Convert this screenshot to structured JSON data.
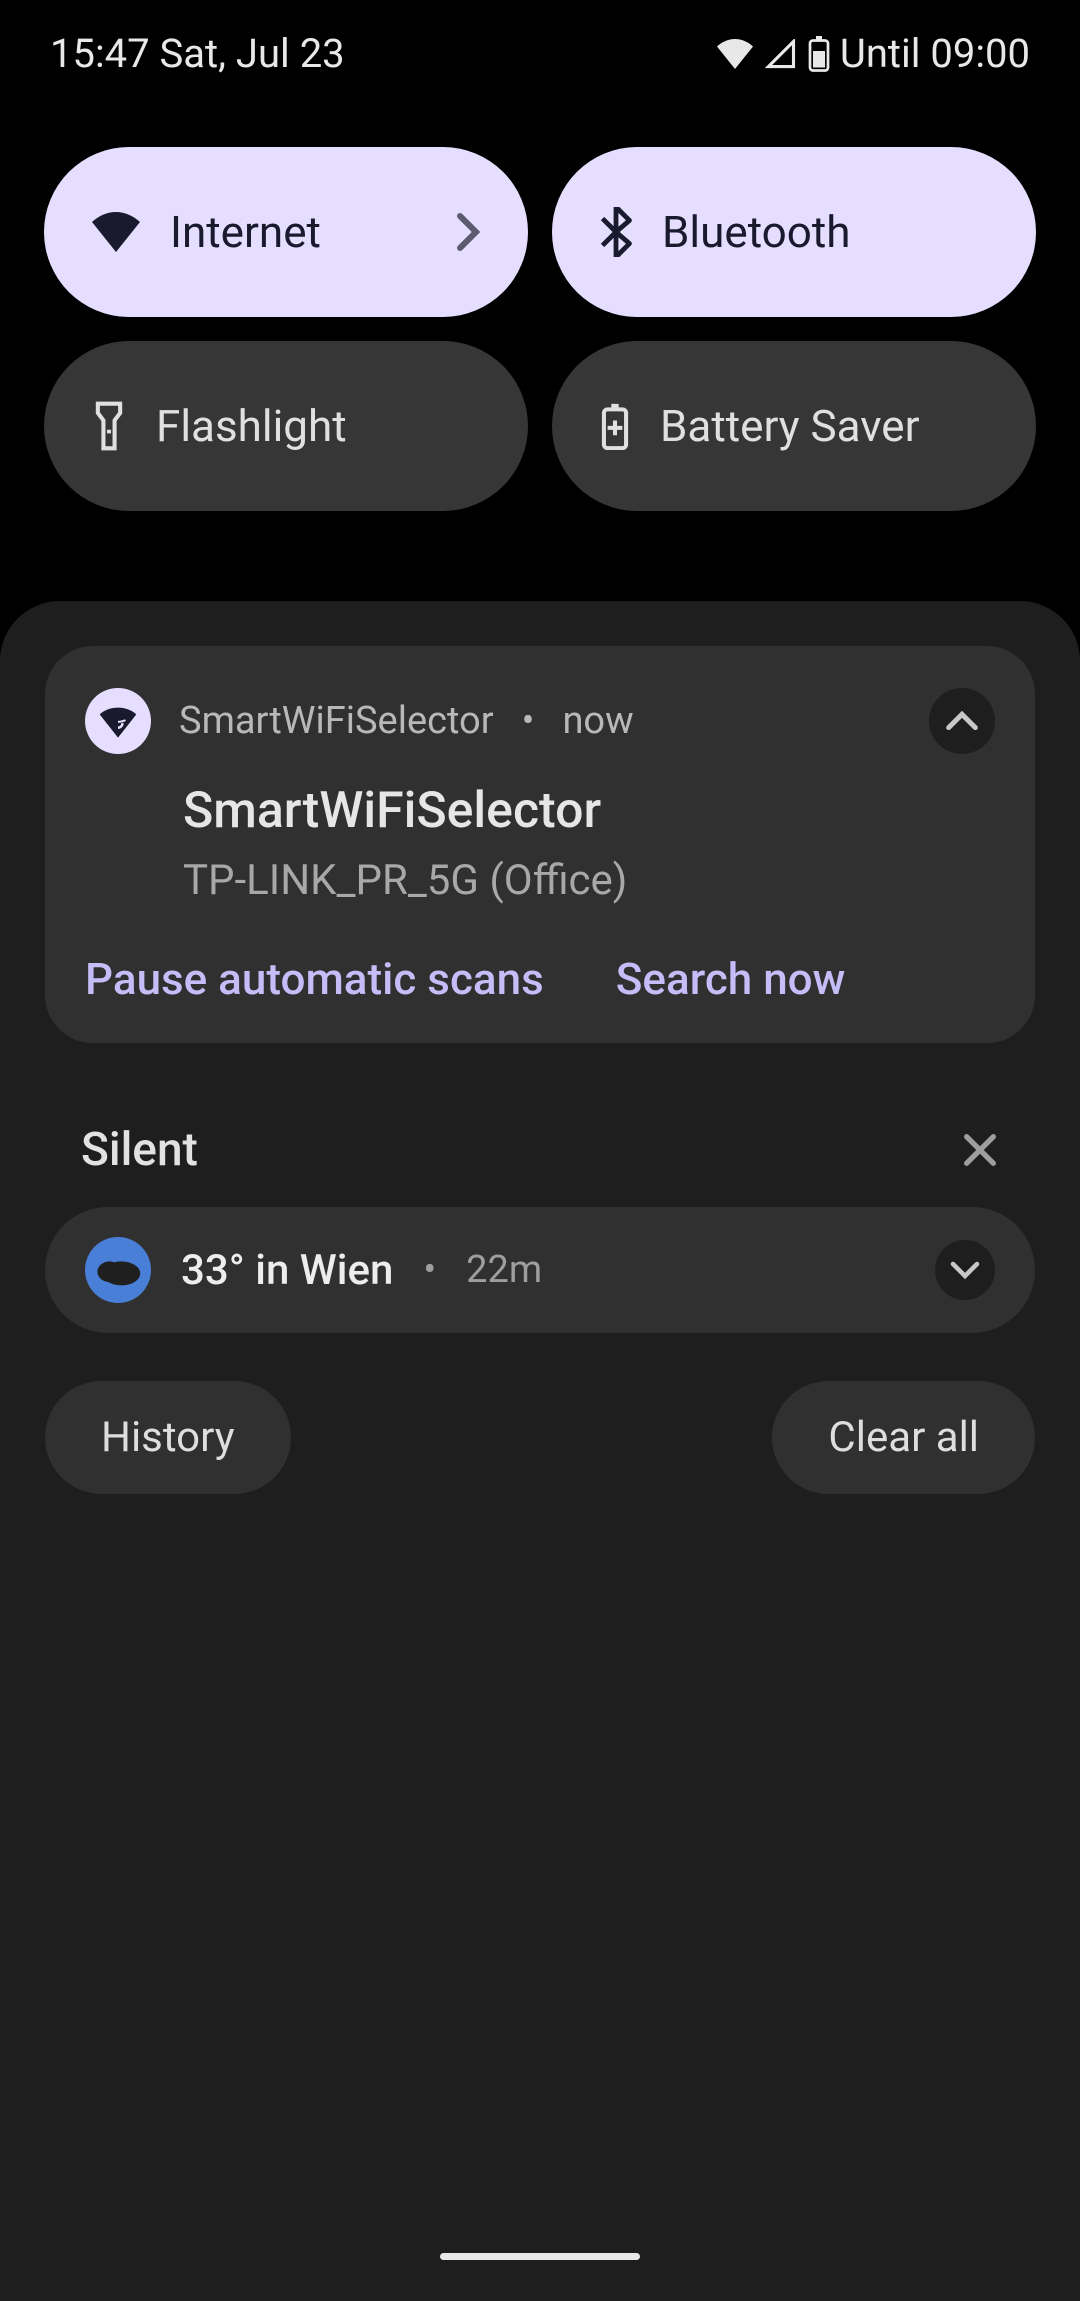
{
  "status": {
    "time": "15:47",
    "date": "Sat, Jul 23",
    "battery_label": "Until 09:00"
  },
  "qs": {
    "internet": {
      "label": "Internet"
    },
    "bluetooth": {
      "label": "Bluetooth"
    },
    "flashlight": {
      "label": "Flashlight"
    },
    "battery_saver": {
      "label": "Battery Saver"
    }
  },
  "notif1": {
    "app": "SmartWiFiSelector",
    "time": "now",
    "title": "SmartWiFiSelector",
    "body": "TP-LINK_PR_5G (Office)",
    "action1": "Pause automatic scans",
    "action2": "Search now"
  },
  "silent": {
    "label": "Silent"
  },
  "notif2": {
    "title": "33° in Wien",
    "time": "22m"
  },
  "footer": {
    "history": "History",
    "clear": "Clear all"
  }
}
